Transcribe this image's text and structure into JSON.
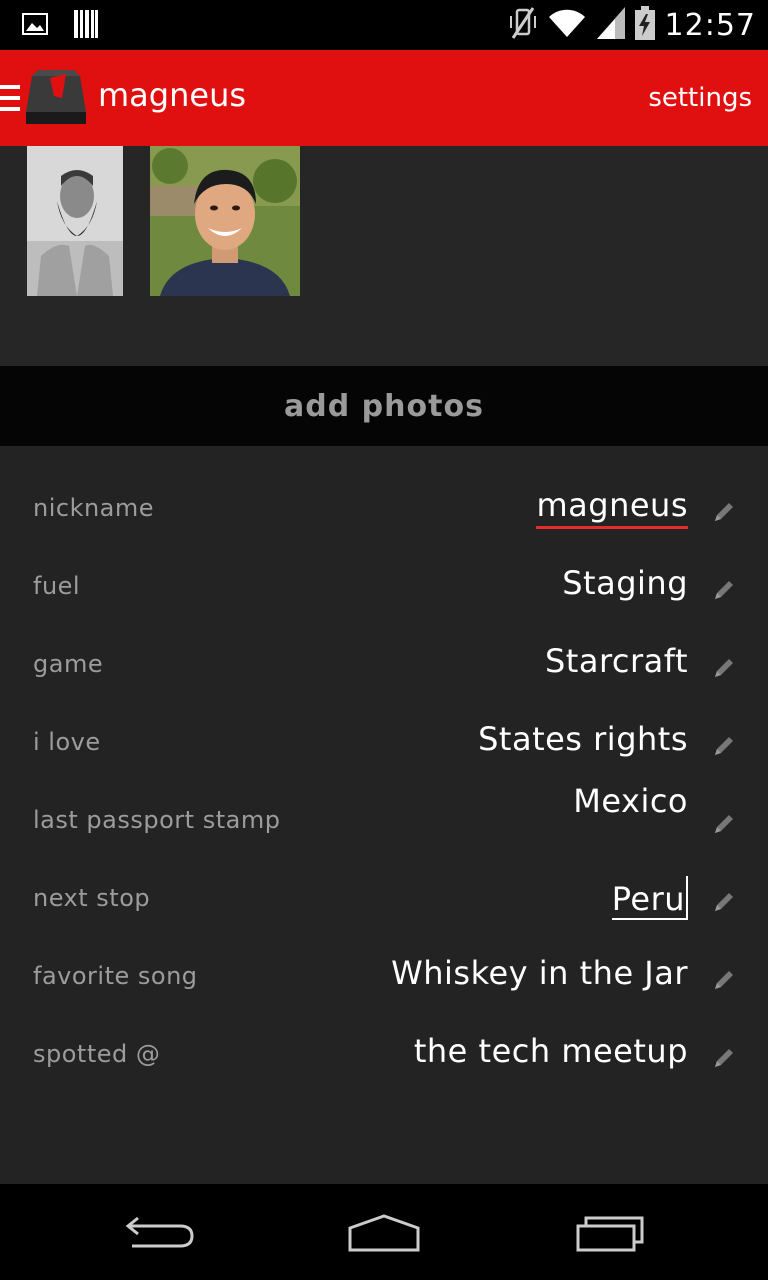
{
  "status_bar": {
    "time": "12:57",
    "icons": [
      "picture-icon",
      "barcode-icon",
      "vibrate-off-icon",
      "wifi-icon",
      "signal-icon",
      "battery-charging-icon"
    ]
  },
  "action_bar": {
    "title": "magneus",
    "settings_label": "settings",
    "icons": [
      "menu-icon",
      "app-logo-icon"
    ]
  },
  "photos": {
    "add_label": "add photos"
  },
  "fields": [
    {
      "label": "nickname",
      "value": "magneus"
    },
    {
      "label": "fuel",
      "value": "Staging"
    },
    {
      "label": "game",
      "value": "Starcraft"
    },
    {
      "label": "i love",
      "value": "States rights"
    },
    {
      "label": "last passport stamp",
      "value": "Mexico"
    },
    {
      "label": "next stop",
      "value": "Peru"
    },
    {
      "label": "favorite song",
      "value": "Whiskey in the Jar"
    },
    {
      "label": "spotted @",
      "value": "the tech meetup"
    }
  ],
  "nav_bar": {
    "icons": [
      "back-icon",
      "home-icon",
      "recent-apps-icon"
    ]
  },
  "colors": {
    "accent": "#e11010",
    "background": "#232323",
    "label": "#9c9c9c"
  }
}
